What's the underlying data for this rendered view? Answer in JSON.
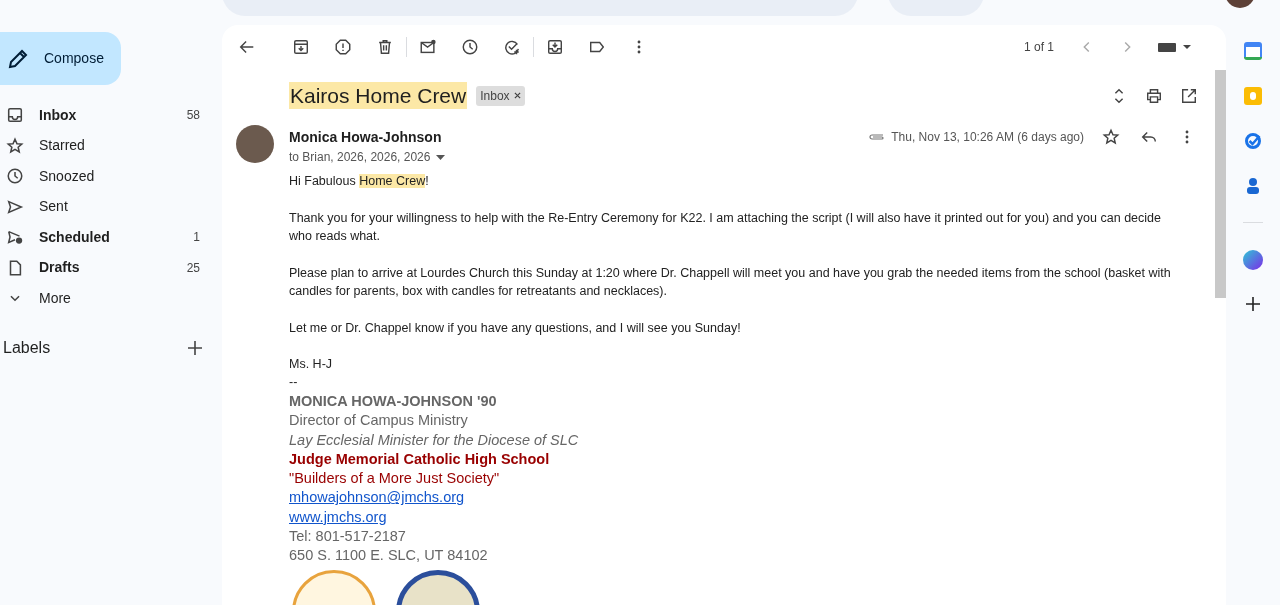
{
  "compose": {
    "label": "Compose"
  },
  "nav": [
    {
      "label": "Inbox",
      "kind": "inbox",
      "count": "58",
      "bold": true
    },
    {
      "label": "Starred",
      "kind": "star",
      "bold": false
    },
    {
      "label": "Snoozed",
      "kind": "clock",
      "bold": false
    },
    {
      "label": "Sent",
      "kind": "send",
      "bold": false
    },
    {
      "label": "Scheduled",
      "kind": "scheduled",
      "count": "1",
      "bold": true
    },
    {
      "label": "Drafts",
      "kind": "file",
      "count": "25",
      "bold": true
    },
    {
      "label": "More",
      "kind": "chevron",
      "bold": false
    }
  ],
  "labels": {
    "title": "Labels"
  },
  "toolbar": {
    "pager": "1 of 1"
  },
  "message": {
    "subject": "Kairos Home Crew",
    "subject_highlighted": true,
    "tag": "Inbox",
    "sender": "Monica Howa-Johnson",
    "recipients": "to Brian, 2026, 2026, 2026",
    "date": "Thu, Nov 13, 10:26 AM (6 days ago)",
    "starred": false,
    "body": [
      [
        {
          "text": "Hi Fabulous ",
          "highlighted": false
        },
        {
          "text": "Home Crew",
          "highlighted": true
        },
        {
          "text": "!",
          "highlighted": false
        }
      ],
      [
        {
          "text": "Thank you for your willingness to help with the Re-Entry Ceremony for K22. I am attaching the script (I will also have it printed out for you) and you can decide who reads what.",
          "highlighted": false
        }
      ],
      [
        {
          "text": "Please plan to arrive at Lourdes Church this Sunday at 1:20 where Dr. Chappell will meet you and have you grab the needed items from the school (basket with candles for parents, box with candles for retreatants and necklaces).",
          "highlighted": false
        }
      ],
      [
        {
          "text": "Let me or Dr. Chappel know if you have any questions, and I will see you Sunday!",
          "highlighted": false
        }
      ]
    ],
    "closing": [
      "Ms. H-J",
      "--"
    ],
    "signature": [
      {
        "text": "MONICA HOWA-JOHNSON '90",
        "kind": "name"
      },
      {
        "text": "Director of Campus Ministry",
        "kind": "plain"
      },
      {
        "text": "Lay Ecclesial Minister for the Diocese of SLC",
        "kind": "italic"
      },
      {
        "text": "Judge Memorial Catholic High School",
        "kind": "school"
      },
      {
        "text": "\"Builders of a More Just Society\"",
        "kind": "motto"
      },
      {
        "text": "mhowajohnson@jmchs.org",
        "kind": "link"
      },
      {
        "text": "www.jmchs.org",
        "kind": "link"
      },
      {
        "text": "Tel: 801-517-2187",
        "kind": "plain"
      },
      {
        "text": "650 S. 1100 E. SLC, UT 84102",
        "kind": "plain"
      }
    ]
  }
}
